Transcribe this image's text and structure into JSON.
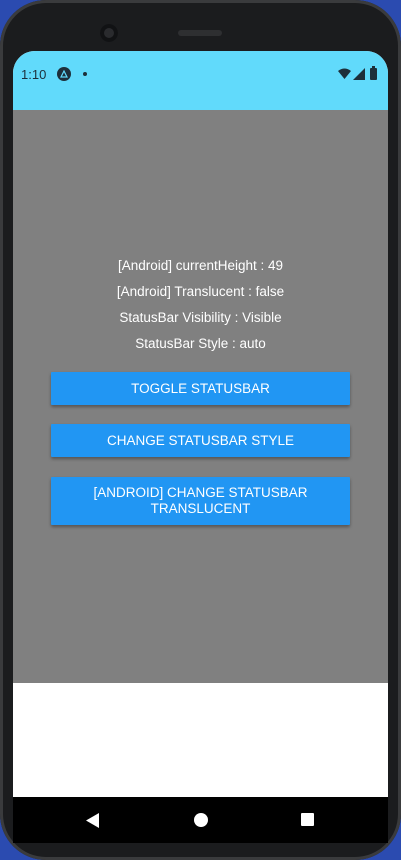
{
  "status_bar": {
    "time": "1:10",
    "icons": [
      "expo-icon",
      "dot-icon",
      "wifi-icon",
      "signal-icon",
      "battery-icon"
    ],
    "background": "#61dafb"
  },
  "content": {
    "background": "#808080",
    "info_lines": [
      "[Android] currentHeight : 49",
      "[Android] Translucent : false",
      "StatusBar Visibility : Visible",
      "StatusBar Style : auto"
    ],
    "buttons": {
      "toggle": "TOGGLE STATUSBAR",
      "change_style": "CHANGE STATUSBAR STYLE",
      "translucent_line1": "[ANDROID] CHANGE STATUSBAR",
      "translucent_line2": "TRANSLUCENT"
    },
    "button_color": "#2196f3"
  },
  "nav_bar": {
    "icons": [
      "back-icon",
      "home-icon",
      "recents-icon"
    ]
  }
}
